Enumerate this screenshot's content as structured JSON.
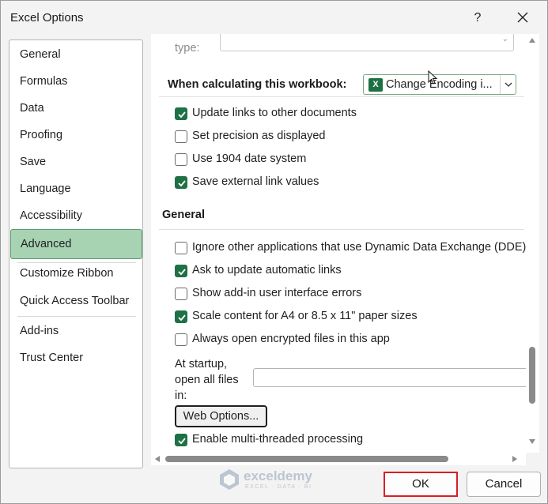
{
  "window": {
    "title": "Excel Options",
    "help_label": "?"
  },
  "sidebar": {
    "items": [
      {
        "label": "General"
      },
      {
        "label": "Formulas"
      },
      {
        "label": "Data"
      },
      {
        "label": "Proofing"
      },
      {
        "label": "Save"
      },
      {
        "label": "Language"
      },
      {
        "label": "Accessibility"
      },
      {
        "label": "Advanced",
        "selected": true
      },
      {
        "label": "Customize Ribbon"
      },
      {
        "label": "Quick Access Toolbar"
      },
      {
        "label": "Add-ins"
      },
      {
        "label": "Trust Center"
      }
    ]
  },
  "content": {
    "type_label": "type:",
    "workbook_section": {
      "label": "When calculating this workbook:",
      "selected_workbook": "Change Encoding i...",
      "options": [
        {
          "label": "Update links to other documents",
          "checked": true
        },
        {
          "label": "Set precision as displayed",
          "checked": false
        },
        {
          "label": "Use 1904 date system",
          "checked": false
        },
        {
          "label": "Save external link values",
          "checked": true
        }
      ]
    },
    "general_section": {
      "label": "General",
      "options": [
        {
          "label": "Ignore other applications that use Dynamic Data Exchange (DDE)",
          "checked": false
        },
        {
          "label": "Ask to update automatic links",
          "checked": true
        },
        {
          "label": "Show add-in user interface errors",
          "checked": false
        },
        {
          "label": "Scale content for A4 or 8.5 x 11\" paper sizes",
          "checked": true
        },
        {
          "label": "Always open encrypted files in this app",
          "checked": false
        }
      ],
      "startup_label_lines": [
        "At startup,",
        "open all files",
        "in:"
      ],
      "startup_value": "",
      "web_options_label": "Web Options...",
      "multithread": {
        "label": "Enable multi-threaded processing",
        "checked": true
      }
    }
  },
  "footer": {
    "ok_label": "OK",
    "cancel_label": "Cancel"
  },
  "watermark": {
    "name": "exceldemy",
    "tagline": "EXCEL · DATA · BI"
  },
  "colors": {
    "accent": "#1e7145",
    "selected_nav": "#a7d3b3",
    "ok_highlight": "#d81e24"
  }
}
